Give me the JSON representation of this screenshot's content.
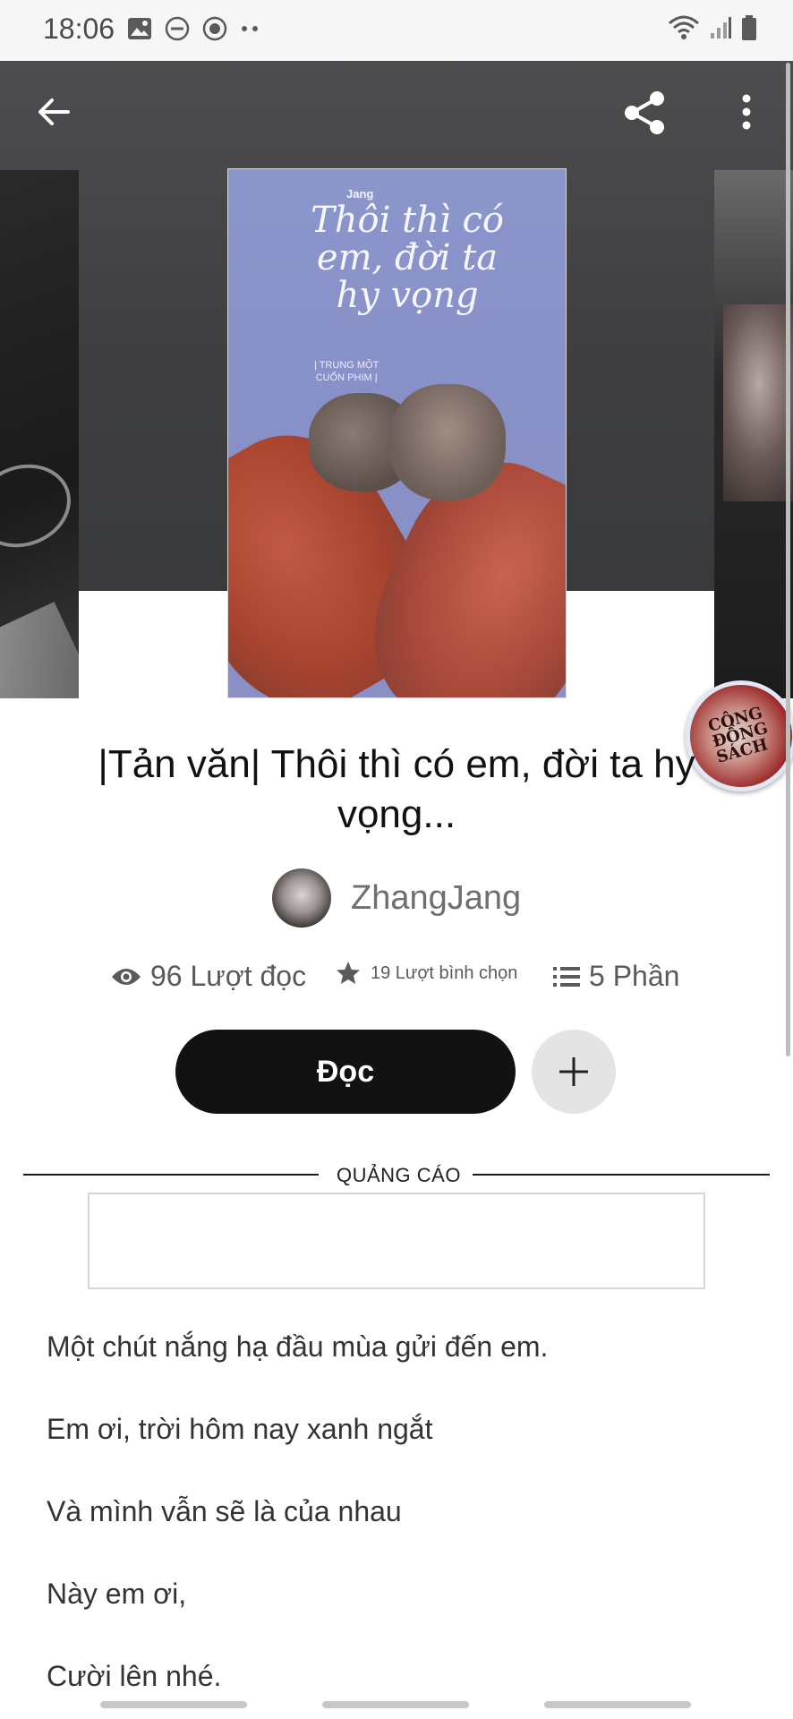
{
  "status_bar": {
    "time": "18:06"
  },
  "story": {
    "title": "|Tản văn| Thôi thì có em, đời ta hy vọng...",
    "author": "ZhangJang",
    "cover": {
      "author": "Jang",
      "title": "Thôi thì có em, đời ta hy vọng",
      "subtitle_line1": "| TRUNG MỘT",
      "subtitle_line2": "CUỐN PHIM |"
    }
  },
  "stats": {
    "reads": "96 Lượt đọc",
    "votes": "19 Lượt bình chọn",
    "parts": "5 Phần"
  },
  "actions": {
    "read_label": "Đọc"
  },
  "ad": {
    "label": "QUẢNG CÁO"
  },
  "excerpt": [
    "Một chút nắng hạ đầu mùa gửi đến em.",
    "Em ơi, trời hôm nay xanh ngắt",
    "Và mình vẫn sẽ là của nhau",
    "Này em ơi,",
    "Cười lên nhé."
  ],
  "floating_bubble": {
    "text": "CỘNG ĐỒNG SÁCH"
  },
  "icons": [
    "back-icon",
    "share-icon",
    "more-vert-icon",
    "eye-icon",
    "star-icon",
    "list-icon",
    "plus-icon"
  ]
}
